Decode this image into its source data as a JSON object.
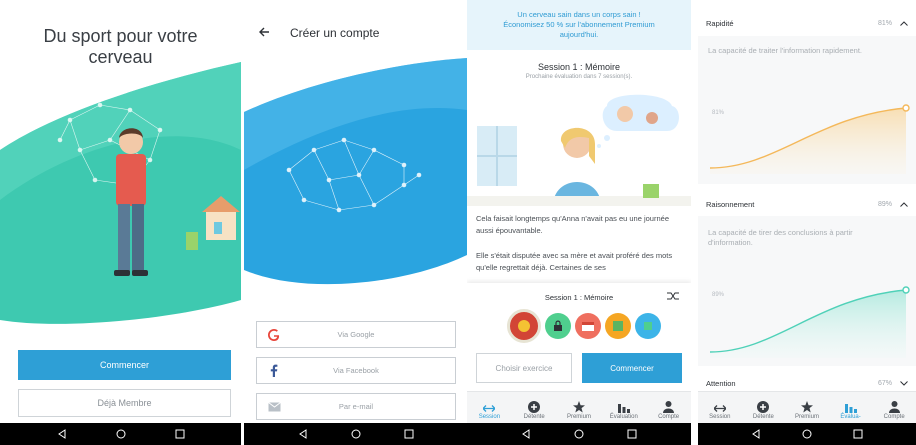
{
  "colors": {
    "primary_blue": "#2e9fd6",
    "teal": "#4fd1b8",
    "orange_curve": "#f4b85a",
    "dark_nav": "#000000"
  },
  "panel1": {
    "title_line1": "Du sport pour votre",
    "title_line2": "cerveau",
    "start_button": "Commencer",
    "member_button": "Déjà Membre"
  },
  "panel2": {
    "title": "Créer un compte",
    "options": [
      {
        "label": "Via Google",
        "icon": "google-icon"
      },
      {
        "label": "Via Facebook",
        "icon": "facebook-icon"
      },
      {
        "label": "Par e-mail",
        "icon": "mail-icon"
      }
    ]
  },
  "panel3": {
    "promo_line1": "Un cerveau sain dans un corps sain !",
    "promo_line2": "Économisez 50 % sur l'abonnement Premium",
    "promo_line3": "aujourd'hui.",
    "session_title": "Session 1 : Mémoire",
    "session_sub": "Prochaine évaluation dans 7 session(s).",
    "story_p1": "Cela faisait longtemps qu'Anna n'avait pas eu une journée aussi épouvantable.",
    "story_p2": "Elle s'était disputée avec sa mère et avait proféré des mots qu'elle regrettait déjà. Certaines de ses",
    "card_title": "Session 1 : Mémoire",
    "choose_button": "Choisir exercice",
    "start_button": "Commencer"
  },
  "tabs": [
    {
      "label": "Session",
      "icon": "arrows-icon"
    },
    {
      "label": "Détente",
      "icon": "plus-circle-icon"
    },
    {
      "label": "Premium",
      "icon": "star-icon"
    },
    {
      "label": "Évaluation",
      "icon": "bar-chart-icon"
    },
    {
      "label": "Compte",
      "icon": "person-icon"
    }
  ],
  "panel4": {
    "sections": [
      {
        "name": "Rapidité",
        "percent": "81%",
        "desc": "La capacité de traiter l'information rapidement.",
        "value_label": "81%"
      },
      {
        "name": "Raisonnement",
        "percent": "89%",
        "desc": "La capacité de tirer des conclusions à partir d'information.",
        "value_label": "89%"
      },
      {
        "name": "Attention",
        "percent": "67%"
      }
    ],
    "tab_eval_short": "Évalua-"
  }
}
